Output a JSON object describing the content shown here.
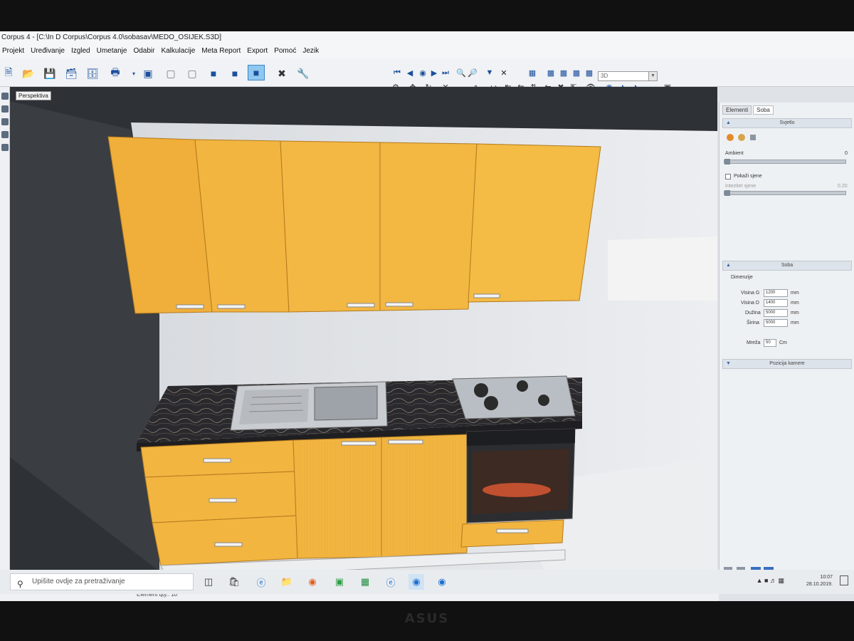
{
  "window": {
    "title": "Corpus 4 - [C:\\In D Corpus\\Corpus 4.0\\sobasav\\MEDO_OSIJEK.S3D]"
  },
  "menu": {
    "items": [
      "Projekt",
      "Uređivanje",
      "Izgled",
      "Umetanje",
      "Odabir",
      "Kalkulacije",
      "Meta Report",
      "Export",
      "Pomoć",
      "Jezik"
    ]
  },
  "toolbar": {
    "view_mode_value": "3D"
  },
  "viewport": {
    "label": "Perspektiva"
  },
  "right_panel": {
    "tabs": [
      "Elementi",
      "Soba"
    ],
    "active_tab": "Soba",
    "lights_section": {
      "title": "Svjetlo",
      "ambient_label": "Ambient",
      "ambient_value": "0",
      "shadow_checkbox_label": "Pokaži sjene",
      "shadow_intensity_label": "Intezitet sjene",
      "shadow_intensity_value": "0.20"
    },
    "room_section": {
      "title": "Soba",
      "dimensions_label": "Dimenzije",
      "fields": [
        {
          "label": "Visina G",
          "value": "1200",
          "unit": "mm"
        },
        {
          "label": "Visina D",
          "value": "1400",
          "unit": "mm"
        },
        {
          "label": "Dužina",
          "value": "5000",
          "unit": "mm"
        },
        {
          "label": "Širina",
          "value": "5000",
          "unit": "mm"
        }
      ],
      "grid_label": "Mreža",
      "grid_value": "50",
      "grid_unit": "Cm"
    },
    "camera_section": {
      "title": "Pozicija kamere"
    }
  },
  "statusbar": {
    "element_count": "Element qty.: 10"
  },
  "taskbar": {
    "search_placeholder": "Upišite ovdje za pretraživanje",
    "time": "10:07",
    "date": "28.10.2019."
  },
  "monitor": {
    "brand": "ASUS"
  },
  "colors": {
    "cabinet": "#f2b540",
    "countertop": "#2b2a2e",
    "wall": "#e4e6ea"
  }
}
